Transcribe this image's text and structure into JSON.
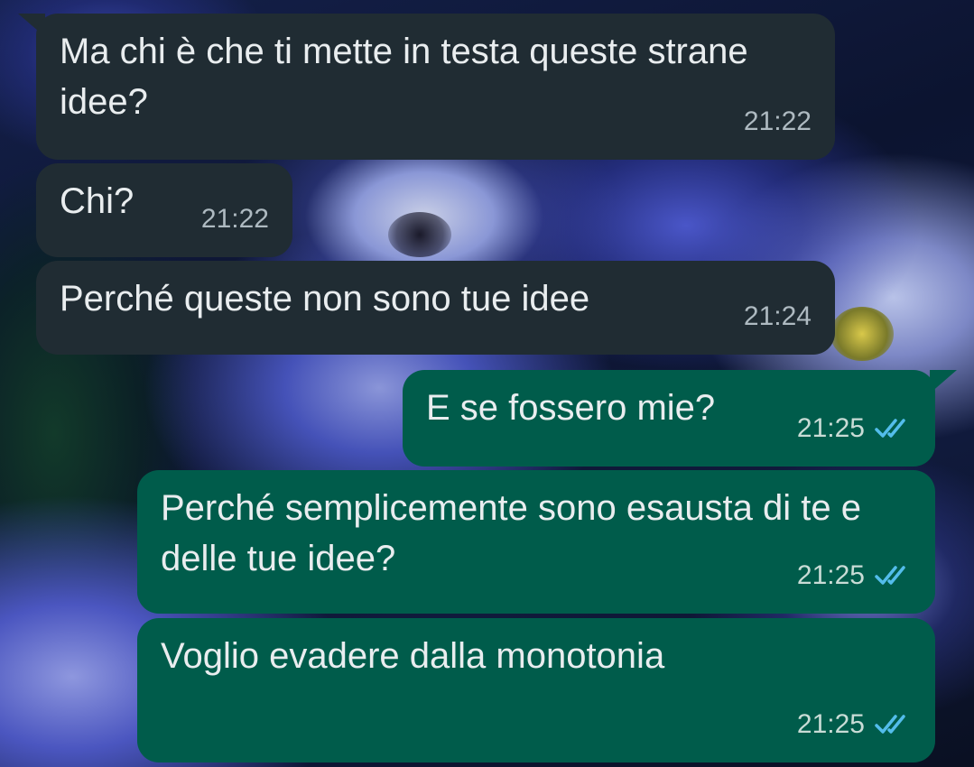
{
  "messages": [
    {
      "direction": "incoming",
      "text": "Ma chi è che ti mette in testa queste strane idee?",
      "time": "21:22"
    },
    {
      "direction": "incoming",
      "text": "Chi?",
      "time": "21:22"
    },
    {
      "direction": "incoming",
      "text": "Perché queste non sono tue idee",
      "time": "21:24"
    },
    {
      "direction": "outgoing",
      "text": "E se fossero mie?",
      "time": "21:25",
      "status": "read"
    },
    {
      "direction": "outgoing",
      "text": "Perché semplicemente sono esausta di te e delle tue idee?",
      "time": "21:25",
      "status": "read"
    },
    {
      "direction": "outgoing",
      "text": "Voglio evadere dalla monotonia",
      "time": "21:25",
      "status": "read"
    }
  ],
  "colors": {
    "incoming_bubble": "#202c33",
    "outgoing_bubble": "#005c4b",
    "read_ticks": "#53bdeb",
    "text": "#e9edef"
  },
  "icons": {
    "read_status": "double-check-icon"
  }
}
